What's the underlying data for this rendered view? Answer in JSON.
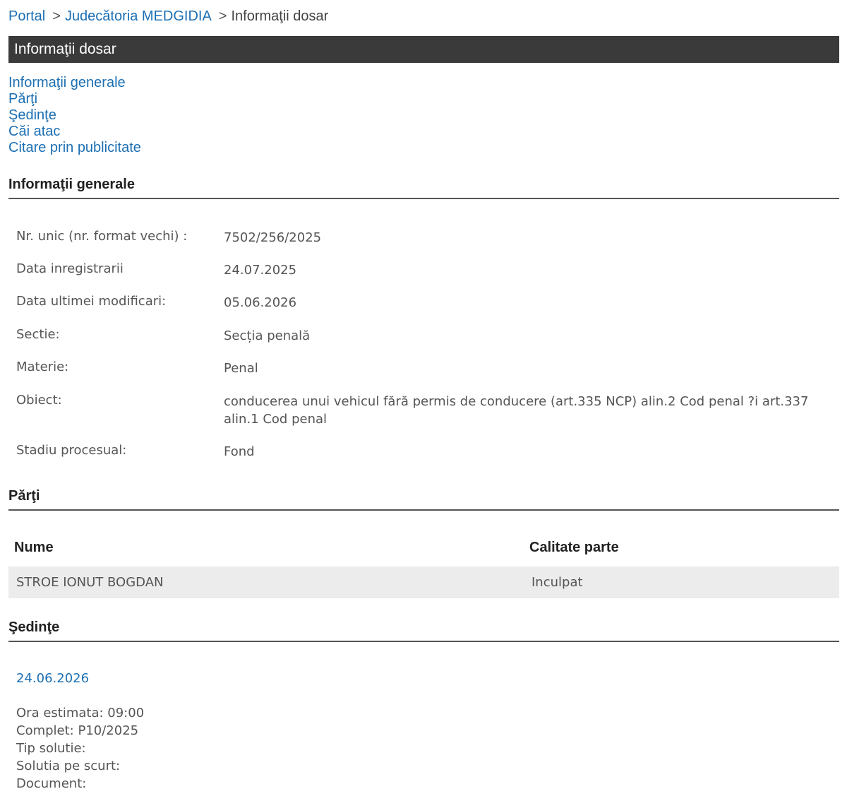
{
  "breadcrumb": {
    "portal": "Portal",
    "court": "Judecătoria MEDGIDIA",
    "current": "Informaţii dosar",
    "separator": ">"
  },
  "title": "Informaţii dosar",
  "toc": [
    "Informaţii generale",
    "Părţi",
    "Şedinţe",
    "Căi atac",
    "Citare prin publicitate"
  ],
  "general": {
    "heading": "Informaţii generale",
    "rows": [
      {
        "label": "Nr. unic (nr. format vechi) :",
        "value": "7502/256/2025"
      },
      {
        "label": "Data inregistrarii",
        "value": "24.07.2025"
      },
      {
        "label": "Data ultimei modificari:",
        "value": "05.06.2026"
      },
      {
        "label": "Sectie:",
        "value": "Secția penală"
      },
      {
        "label": "Materie:",
        "value": "Penal"
      },
      {
        "label": "Obiect:",
        "value": "conducerea unui vehicul fără permis de conducere (art.335 NCP) alin.2 Cod penal ?i art.337 alin.1 Cod penal"
      },
      {
        "label": "Stadiu procesual:",
        "value": "Fond"
      }
    ]
  },
  "parties": {
    "heading": "Părţi",
    "columns": [
      "Nume",
      "Calitate parte"
    ],
    "rows": [
      {
        "name": "STROE IONUT BOGDAN",
        "role": "Inculpat"
      }
    ]
  },
  "sessions": {
    "heading": "Şedinţe",
    "items": [
      {
        "date": "24.06.2026",
        "details": [
          "Ora estimata: 09:00",
          "Complet: P10/2025",
          "Tip solutie:",
          "Solutia pe scurt:",
          "Document:"
        ]
      }
    ]
  },
  "colors": {
    "link": "#1c6fb3",
    "title_bar": "#3a3a3a",
    "row_bg": "#ececec",
    "text": "#555555"
  }
}
